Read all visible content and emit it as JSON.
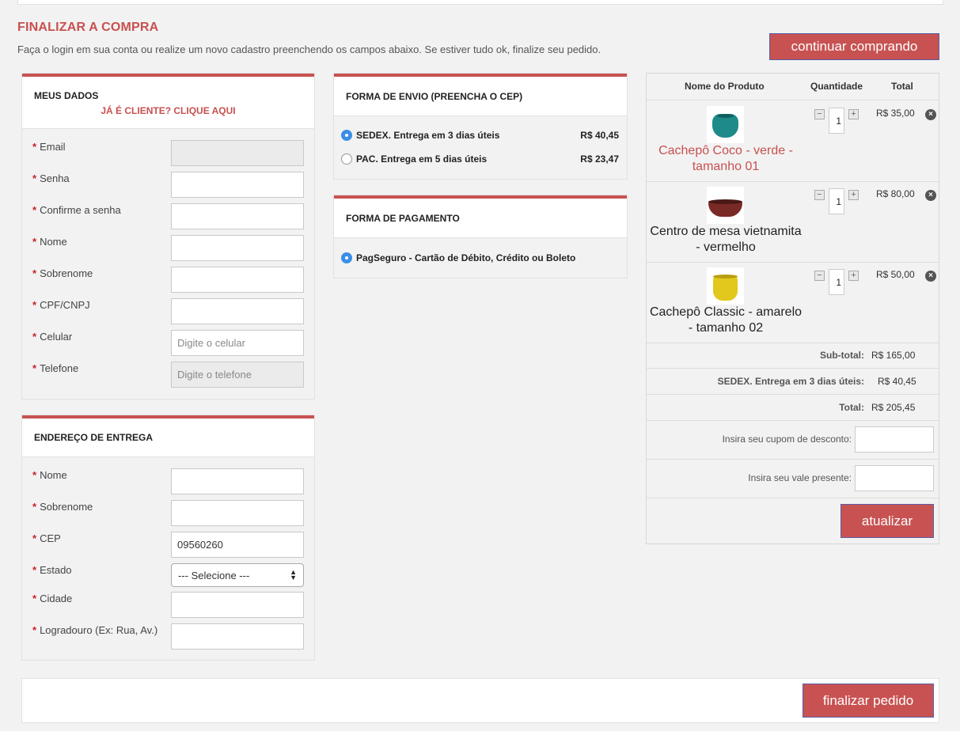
{
  "header": {
    "title": "FINALIZAR A COMPRA",
    "subtitle": "Faça o login em sua conta ou realize um novo cadastro preenchendo os campos abaixo. Se estiver tudo ok, finalize seu pedido.",
    "continue_label": "continuar comprando"
  },
  "dados": {
    "title": "MEUS DADOS",
    "login_link": "JÁ É CLIENTE? CLIQUE AQUI",
    "fields": [
      {
        "label": "Email",
        "value": "",
        "placeholder": ""
      },
      {
        "label": "Senha",
        "value": "",
        "placeholder": ""
      },
      {
        "label": "Confirme a senha",
        "value": "",
        "placeholder": ""
      },
      {
        "label": "Nome",
        "value": "",
        "placeholder": ""
      },
      {
        "label": "Sobrenome",
        "value": "",
        "placeholder": ""
      },
      {
        "label": "CPF/CNPJ",
        "value": "",
        "placeholder": ""
      },
      {
        "label": "Celular",
        "value": "",
        "placeholder": "Digite o celular"
      },
      {
        "label": "Telefone",
        "value": "",
        "placeholder": "Digite o telefone"
      }
    ]
  },
  "endereco": {
    "title": "ENDEREÇO DE ENTREGA",
    "fields": [
      {
        "label": "Nome",
        "value": ""
      },
      {
        "label": "Sobrenome",
        "value": ""
      },
      {
        "label": "CEP",
        "value": "09560260"
      },
      {
        "label": "Estado",
        "value": "--- Selecione ---"
      },
      {
        "label": "Cidade",
        "value": ""
      },
      {
        "label": "Logradouro (Ex: Rua, Av.)",
        "value": ""
      }
    ]
  },
  "envio": {
    "title": "FORMA DE ENVIO (PREENCHA O CEP)",
    "options": [
      {
        "label": "SEDEX. Entrega em 3 dias úteis",
        "price": "R$ 40,45",
        "selected": true
      },
      {
        "label": "PAC. Entrega em 5 dias úteis",
        "price": "R$ 23,47",
        "selected": false
      }
    ]
  },
  "pagamento": {
    "title": "FORMA DE PAGAMENTO",
    "options": [
      {
        "label": "PagSeguro - Cartão de Débito, Crédito ou Boleto",
        "selected": true
      }
    ]
  },
  "cart": {
    "headers": {
      "product": "Nome do Produto",
      "quantity": "Quantidade",
      "total": "Total"
    },
    "items": [
      {
        "name": "Cachepô Coco - verde - tamanho 01",
        "qty": "1",
        "total": "R$ 35,00",
        "color": "#1f8a8a"
      },
      {
        "name": "Centro de mesa vietnamita - vermelho",
        "qty": "1",
        "total": "R$ 80,00",
        "color": "#7a2a26"
      },
      {
        "name": "Cachepô Classic - amarelo - tamanho 02",
        "qty": "1",
        "total": "R$ 50,00",
        "color": "#e2c81c"
      }
    ],
    "subtotal_label": "Sub-total:",
    "subtotal_value": "R$ 165,00",
    "shipping_label": "SEDEX. Entrega em 3 dias úteis:",
    "shipping_value": "R$ 40,45",
    "total_label": "Total:",
    "total_value": "R$ 205,45",
    "coupon_label": "Insira seu cupom de desconto:",
    "gift_label": "Insira seu vale presente:",
    "update_label": "atualizar"
  },
  "footer": {
    "finish_label": "finalizar pedido"
  },
  "colors": {
    "accent": "#c85252",
    "radio_selected": "#3b8ee8"
  }
}
